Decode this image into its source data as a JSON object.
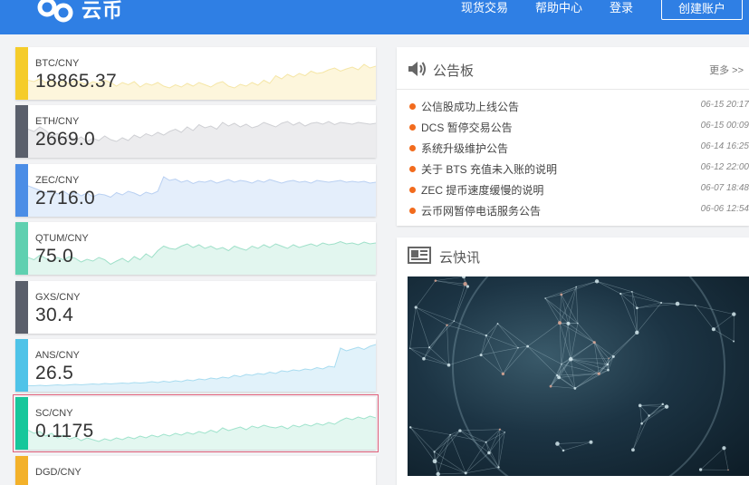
{
  "header": {
    "logo_text": "云币",
    "nav": [
      "现货交易",
      "帮助中心",
      "登录"
    ],
    "signup_label": "创建账户",
    "bg_color": "#2f7fe4"
  },
  "tickers": [
    {
      "pair": "BTC/CNY",
      "price": "18865.37",
      "color": "#f5cc2a",
      "fill": "#fdf6dc",
      "stroke": "#f5e6a6",
      "trend": [
        0.35,
        0.32,
        0.38,
        0.3,
        0.34,
        0.28,
        0.33,
        0.27,
        0.35,
        0.3,
        0.25,
        0.32,
        0.28,
        0.35,
        0.3,
        0.22,
        0.3,
        0.25,
        0.32,
        0.2,
        0.28,
        0.24,
        0.3,
        0.22,
        0.18,
        0.25,
        0.2,
        0.28,
        0.22,
        0.3,
        0.25,
        0.2,
        0.28,
        0.32,
        0.22,
        0.18,
        0.26,
        0.22,
        0.3,
        0.24,
        0.35,
        0.28,
        0.45,
        0.38,
        0.48,
        0.42,
        0.5,
        0.45,
        0.55,
        0.5,
        0.52,
        0.58,
        0.62,
        0.55,
        0.6,
        0.64,
        0.58,
        0.7,
        0.62,
        0.66
      ]
    },
    {
      "pair": "ETH/CNY",
      "price": "2669.0",
      "color": "#5a5f6b",
      "fill": "#ececee",
      "stroke": "#cfd0d4",
      "trend": [
        0.55,
        0.5,
        0.6,
        0.52,
        0.4,
        0.45,
        0.35,
        0.42,
        0.3,
        0.38,
        0.28,
        0.35,
        0.3,
        0.4,
        0.32,
        0.28,
        0.36,
        0.3,
        0.42,
        0.36,
        0.45,
        0.4,
        0.48,
        0.42,
        0.5,
        0.55,
        0.48,
        0.6,
        0.52,
        0.65,
        0.58,
        0.62,
        0.55,
        0.7,
        0.62,
        0.68,
        0.6,
        0.66,
        0.58,
        0.62,
        0.7,
        0.65,
        0.6,
        0.68,
        0.72,
        0.64,
        0.7,
        0.62,
        0.68,
        0.7,
        0.66,
        0.72,
        0.65,
        0.7,
        0.68,
        0.66,
        0.7,
        0.68,
        0.66,
        0.68
      ]
    },
    {
      "pair": "ZEC/CNY",
      "price": "2716.0",
      "color": "#4b8de6",
      "fill": "#e4eefb",
      "stroke": "#b9d0f2",
      "trend": [
        0.6,
        0.55,
        0.5,
        0.45,
        0.5,
        0.42,
        0.48,
        0.4,
        0.46,
        0.38,
        0.44,
        0.36,
        0.42,
        0.4,
        0.35,
        0.45,
        0.4,
        0.48,
        0.44,
        0.38,
        0.46,
        0.42,
        0.48,
        0.8,
        0.72,
        0.75,
        0.68,
        0.72,
        0.65,
        0.7,
        0.68,
        0.72,
        0.66,
        0.7,
        0.74,
        0.68,
        0.72,
        0.7,
        0.66,
        0.72,
        0.68,
        0.74,
        0.7,
        0.66,
        0.7,
        0.72,
        0.68,
        0.7,
        0.66,
        0.72,
        0.7,
        0.68,
        0.7,
        0.72,
        0.68,
        0.7,
        0.68,
        0.7,
        0.66,
        0.68
      ]
    },
    {
      "pair": "QTUM/CNY",
      "price": "75.0",
      "color": "#5fd0b0",
      "fill": "#e2f6ef",
      "stroke": "#9fe0c9",
      "trend": [
        0.3,
        0.25,
        0.35,
        0.28,
        0.22,
        0.3,
        0.25,
        0.32,
        0.28,
        0.2,
        0.26,
        0.22,
        0.3,
        0.25,
        0.15,
        0.22,
        0.28,
        0.2,
        0.32,
        0.25,
        0.38,
        0.3,
        0.45,
        0.55,
        0.5,
        0.48,
        0.55,
        0.6,
        0.52,
        0.58,
        0.5,
        0.55,
        0.48,
        0.52,
        0.45,
        0.55,
        0.5,
        0.46,
        0.55,
        0.5,
        0.58,
        0.52,
        0.6,
        0.55,
        0.5,
        0.58,
        0.52,
        0.56,
        0.6,
        0.55,
        0.62,
        0.58,
        0.6,
        0.65,
        0.6,
        0.62,
        0.58,
        0.64,
        0.6,
        0.62
      ]
    },
    {
      "pair": "GXS/CNY",
      "price": "30.4",
      "color": "#5a5f6b",
      "fill": "#ffffff",
      "stroke": "#ffffff",
      "trend": []
    },
    {
      "pair": "ANS/CNY",
      "price": "26.5",
      "color": "#4fc3e8",
      "fill": "#e1f2fa",
      "stroke": "#a8dcf0",
      "trend": [
        0.05,
        0.05,
        0.06,
        0.05,
        0.06,
        0.07,
        0.06,
        0.07,
        0.08,
        0.07,
        0.08,
        0.09,
        0.08,
        0.1,
        0.09,
        0.1,
        0.11,
        0.1,
        0.12,
        0.11,
        0.12,
        0.14,
        0.12,
        0.15,
        0.13,
        0.16,
        0.14,
        0.18,
        0.16,
        0.2,
        0.18,
        0.22,
        0.2,
        0.24,
        0.22,
        0.28,
        0.25,
        0.3,
        0.28,
        0.32,
        0.3,
        0.35,
        0.32,
        0.38,
        0.36,
        0.4,
        0.38,
        0.42,
        0.4,
        0.45,
        0.42,
        0.48,
        0.46,
        0.88,
        0.82,
        0.86,
        0.9,
        0.85,
        0.92,
        0.96
      ]
    },
    {
      "pair": "SC/CNY",
      "price": "0.1175",
      "color": "#16c79b",
      "fill": "#e3f7f0",
      "stroke": "#9fe3cc",
      "trend": [
        0.35,
        0.28,
        0.32,
        0.22,
        0.28,
        0.18,
        0.24,
        0.15,
        0.2,
        0.12,
        0.18,
        0.14,
        0.1,
        0.16,
        0.12,
        0.18,
        0.14,
        0.2,
        0.16,
        0.22,
        0.18,
        0.24,
        0.2,
        0.26,
        0.22,
        0.28,
        0.24,
        0.3,
        0.26,
        0.32,
        0.28,
        0.35,
        0.3,
        0.4,
        0.34,
        0.38,
        0.42,
        0.36,
        0.44,
        0.4,
        0.46,
        0.42,
        0.4,
        0.44,
        0.38,
        0.46,
        0.42,
        0.48,
        0.44,
        0.5,
        0.46,
        0.52,
        0.48,
        0.56,
        0.62,
        0.58,
        0.64,
        0.6,
        0.66,
        0.62
      ]
    },
    {
      "pair": "DGD/CNY",
      "price": "",
      "color": "#f3b12a",
      "fill": "#ffffff",
      "stroke": "#ffffff",
      "trend": []
    }
  ],
  "notice": {
    "title": "公告板",
    "more": "更多 >>",
    "items": [
      {
        "text": "公信股成功上线公告",
        "date": "06-15 20:17"
      },
      {
        "text": "DCS 暂停交易公告",
        "date": "06-15 00:09"
      },
      {
        "text": "系统升级维护公告",
        "date": "06-14 16:25"
      },
      {
        "text": "关于 BTS 充值未入账的说明",
        "date": "06-12 22:00"
      },
      {
        "text": "ZEC 提币速度缓慢的说明",
        "date": "06-07 18:48"
      },
      {
        "text": "云币网暂停电话服务公告",
        "date": "06-06 12:54"
      }
    ],
    "bullet_color": "#f26b1d"
  },
  "news": {
    "title": "云快讯"
  }
}
